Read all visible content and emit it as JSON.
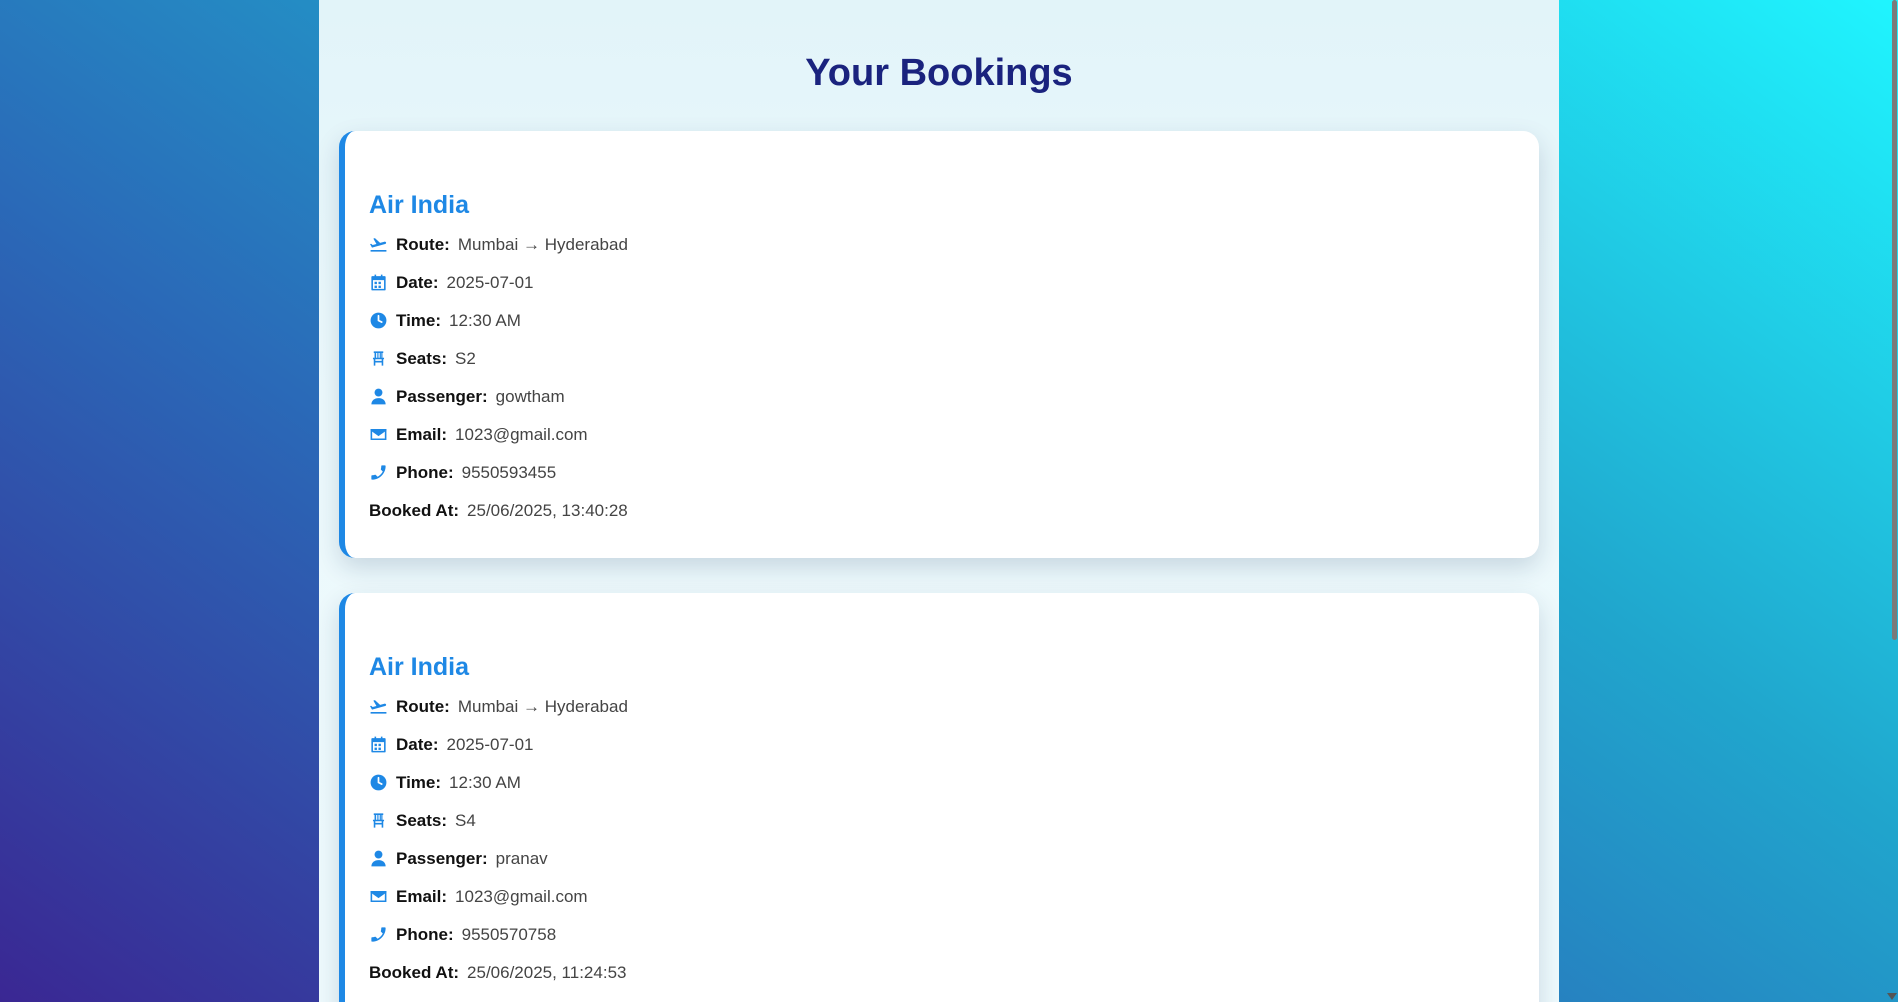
{
  "page": {
    "title": "Your Bookings"
  },
  "colors": {
    "accent": "#1e88e5",
    "title": "#1a237e"
  },
  "bookings": [
    {
      "airline": "Air India",
      "route_label": "Route:",
      "route": "Mumbai → Hyderabad",
      "date_label": "Date:",
      "date": "2025-07-01",
      "time_label": "Time:",
      "time": "12:30 AM",
      "seats_label": "Seats:",
      "seats": "S2",
      "passenger_label": "Passenger:",
      "passenger": "gowtham",
      "email_label": "Email:",
      "email": "1023@gmail.com",
      "phone_label": "Phone:",
      "phone": "9550593455",
      "booked_at_label": "Booked At:",
      "booked_at": "25/06/2025, 13:40:28"
    },
    {
      "airline": "Air India",
      "route_label": "Route:",
      "route": "Mumbai → Hyderabad",
      "date_label": "Date:",
      "date": "2025-07-01",
      "time_label": "Time:",
      "time": "12:30 AM",
      "seats_label": "Seats:",
      "seats": "S4",
      "passenger_label": "Passenger:",
      "passenger": "pranav",
      "email_label": "Email:",
      "email": "1023@gmail.com",
      "phone_label": "Phone:",
      "phone": "9550570758",
      "booked_at_label": "Booked At:",
      "booked_at": "25/06/2025, 11:24:53"
    }
  ],
  "icons": [
    "plane-departure-icon",
    "calendar-icon",
    "clock-icon",
    "chair-icon",
    "user-icon",
    "envelope-icon",
    "phone-icon"
  ]
}
